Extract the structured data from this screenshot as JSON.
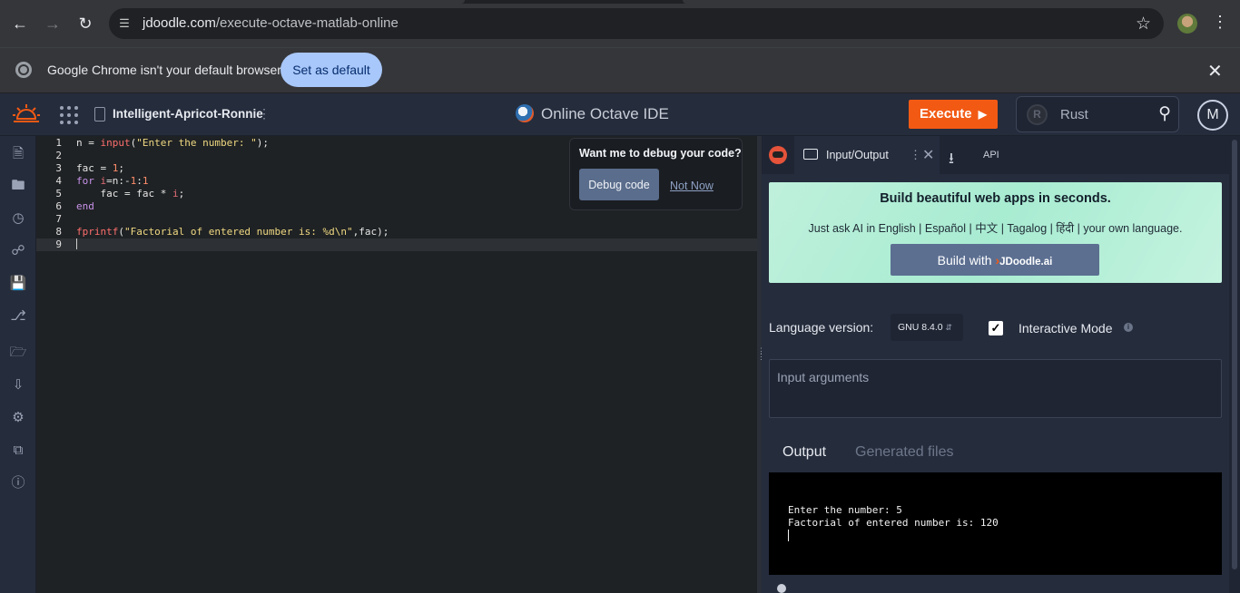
{
  "browser": {
    "url_host": "jdoodle.com",
    "url_path": "/execute-octave-matlab-online",
    "infobar_message": "Google Chrome isn't your default browser",
    "set_default_label": "Set as default"
  },
  "header": {
    "project_name": "Intelligent-Apricot-Ronnie",
    "ide_title": "Online Octave IDE",
    "execute_label": "Execute",
    "language_search": "Rust",
    "avatar_initial": "M"
  },
  "sidebar": {
    "items": [
      "new-file-icon",
      "folder-icon",
      "history-icon",
      "share-icon",
      "save-icon",
      "fork-icon",
      "upload-folder-icon",
      "download-icon",
      "settings-icon",
      "copy-icon",
      "help-icon"
    ]
  },
  "editor": {
    "line_numbers": [
      "1",
      "2",
      "3",
      "4",
      "5",
      "6",
      "7",
      "8",
      "9"
    ]
  },
  "debug_popup": {
    "question": "Want me to debug your code?",
    "debug_label": "Debug code",
    "not_now_label": "Not Now"
  },
  "right_panel": {
    "tab_label": "Input/Output",
    "api_label": "API",
    "promo_title": "Build beautiful web apps in seconds.",
    "promo_sub": "Just ask AI in English | Español | 中文 | Tagalog | हिंदी | your own language.",
    "promo_btn": "Build with",
    "promo_brand": "JDoodle.ai",
    "language_version_label": "Language version:",
    "language_version_value": "GNU 8.4.0",
    "interactive_mode_label": "Interactive Mode",
    "input_placeholder": "Input arguments",
    "output_tab": "Output",
    "generated_files_tab": "Generated files",
    "output_line_1": "Enter the number: 5",
    "output_line_2": "Factorial of entered number is: 120"
  }
}
